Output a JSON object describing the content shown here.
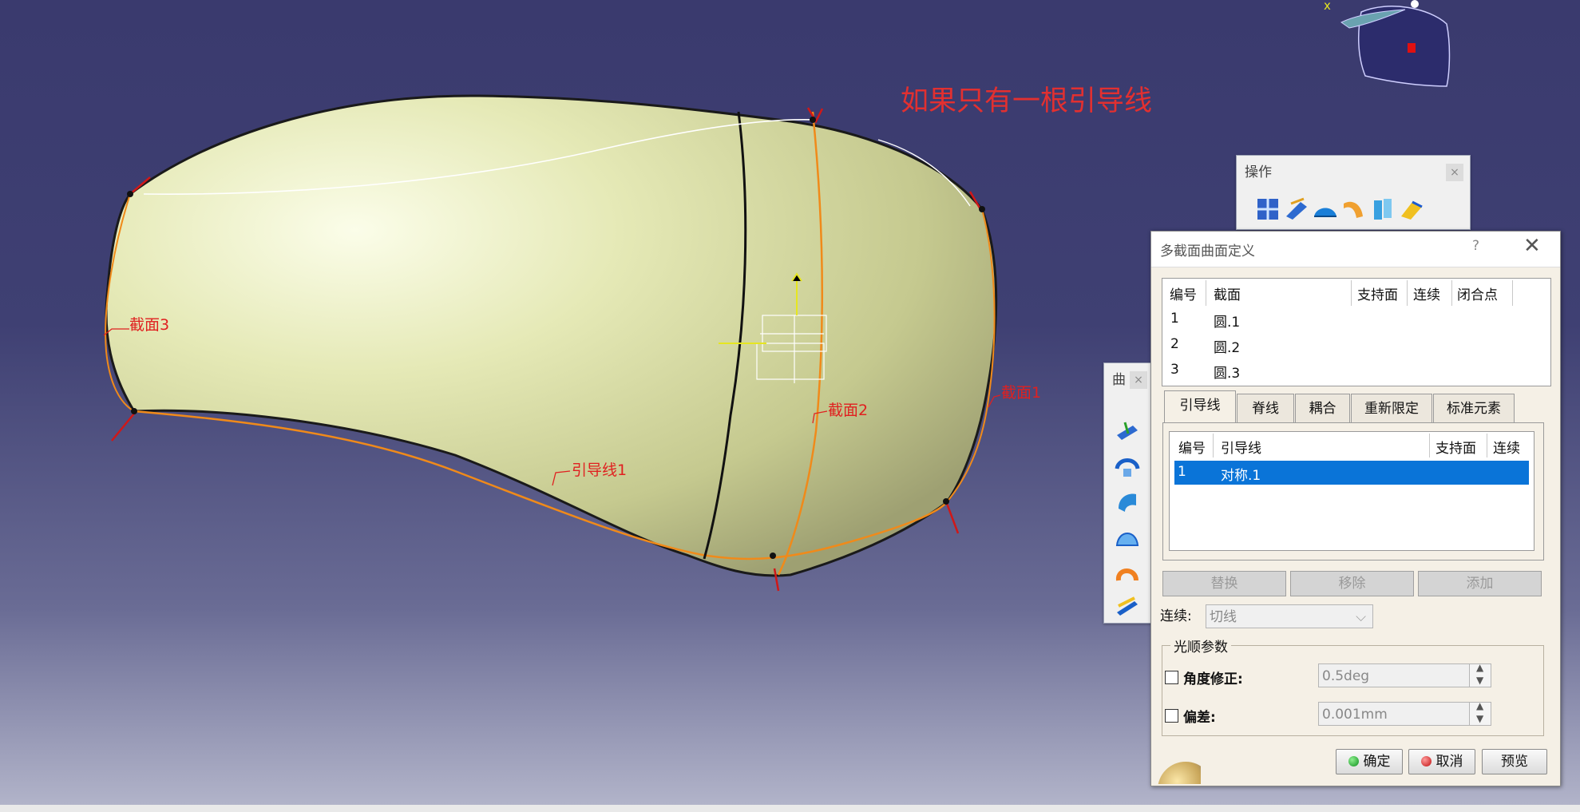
{
  "annotation": {
    "title": "如果只有一根引导线",
    "section3": "截面3",
    "section2": "截面2",
    "section1": "截面1",
    "guide1": "引导线1"
  },
  "compass": {
    "axis_label": "x"
  },
  "toolbar_ops": {
    "title": "操作",
    "close": "×",
    "icons": [
      "join-icon",
      "healing-icon",
      "fillet-icon",
      "trim-icon",
      "extract-icon",
      "transform-icon"
    ]
  },
  "toolbar_surfaces": {
    "title": "曲",
    "close": "×",
    "icons": [
      "extrude-icon",
      "revolve-icon",
      "sweep-icon",
      "fill-icon",
      "multisection-icon",
      "blend-icon"
    ]
  },
  "dialog": {
    "title": "多截面曲面定义",
    "help": "?",
    "close": "✕",
    "sections_table": {
      "headers": [
        "编号",
        "截面",
        "支持面",
        "连续",
        "闭合点"
      ],
      "rows": [
        {
          "num": "1",
          "section": "圆.1"
        },
        {
          "num": "2",
          "section": "圆.2"
        },
        {
          "num": "3",
          "section": "圆.3"
        }
      ]
    },
    "tabs": [
      "引导线",
      "脊线",
      "耦合",
      "重新限定",
      "标准元素"
    ],
    "guides_table": {
      "headers": [
        "编号",
        "引导线",
        "支持面",
        "连续"
      ],
      "rows": [
        {
          "num": "1",
          "guide": "对称.1"
        }
      ]
    },
    "buttons": {
      "replace": "替换",
      "remove": "移除",
      "add": "添加",
      "ok": "确定",
      "cancel": "取消",
      "preview": "预览"
    },
    "continuity": {
      "label": "连续:",
      "value": "切线"
    },
    "smoothing": {
      "group_label": "光顺参数",
      "angle_label": "角度修正:",
      "angle_value": "0.5deg",
      "deviation_label": "偏差:",
      "deviation_value": "0.001mm"
    }
  }
}
